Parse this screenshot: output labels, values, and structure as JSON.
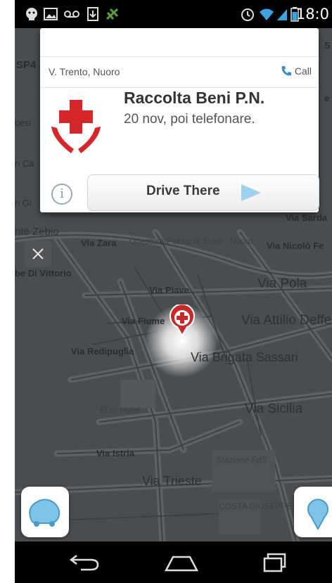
{
  "status_bar": {
    "time": "18:0"
  },
  "map": {
    "streets": [
      {
        "label": "SP4"
      },
      {
        "label": "cesi"
      },
      {
        "label": "n Ca"
      },
      {
        "label": "n Gi"
      },
      {
        "label": "nte Zebio"
      },
      {
        "label": "Via Zara"
      },
      {
        "label": "Questura/Polizia di Stato - Nuoro"
      },
      {
        "label": "Via Nicolò Fe"
      },
      {
        "label": "be Di Vittorio"
      },
      {
        "label": "Via Pola"
      },
      {
        "label": "Via Piave"
      },
      {
        "label": "Via Fiume"
      },
      {
        "label": "Via Attilio Deffe"
      },
      {
        "label": "Via Redipuglia"
      },
      {
        "label": "Via Brigata Sassari"
      },
      {
        "label": "Euro Hotel"
      },
      {
        "label": "Via Sicilia"
      },
      {
        "label": "Via Istria"
      },
      {
        "label": "Stazione FdS"
      },
      {
        "label": "Via Trieste"
      },
      {
        "label": "COSTA GIUSEPPE"
      },
      {
        "label": "Via Sarda"
      },
      {
        "label": "e"
      },
      {
        "label": "S"
      }
    ]
  },
  "card": {
    "address": "V. Trento, Nuoro",
    "call_label": "Call",
    "title": "Raccolta Beni P.N.",
    "subtitle": "20 nov, poi telefonare.",
    "info_label": "i",
    "drive_label": "Drive There"
  }
}
